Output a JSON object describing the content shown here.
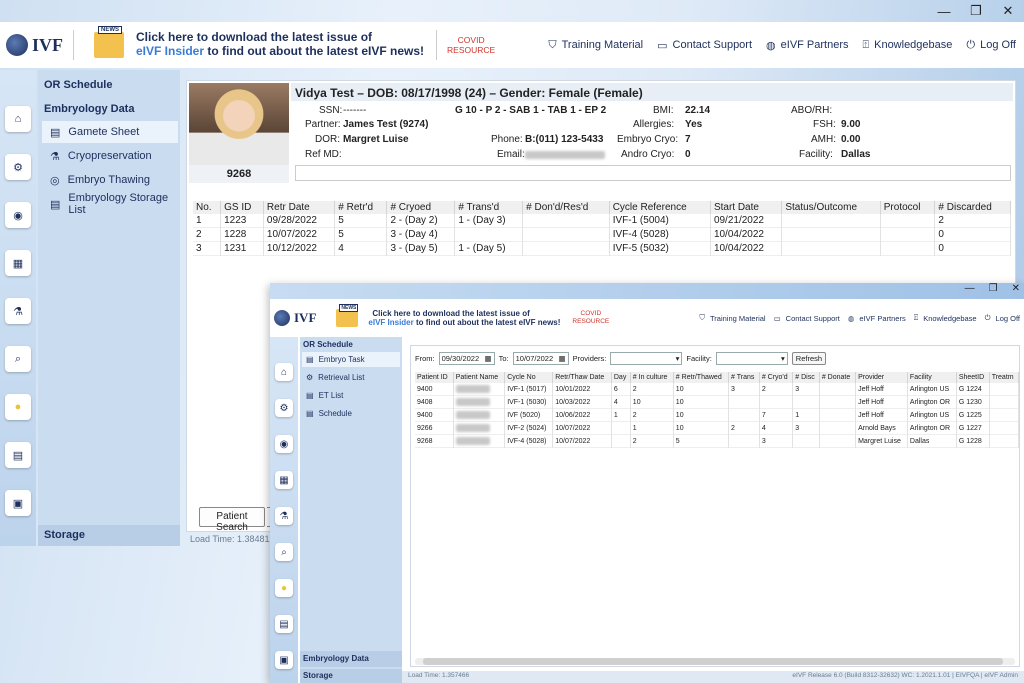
{
  "main": {
    "banner": {
      "line1": "Click here to download the latest issue of",
      "line2_hl": "eIVF Insider",
      "line2_rest": " to find out about the latest eIVF news!"
    },
    "covid": [
      "COVID",
      "RESOURCE"
    ],
    "logo_text": "IVF",
    "news_label": "NEWS",
    "nav": [
      "Training Material",
      "Contact Support",
      "eIVF Partners",
      "Knowledgebase",
      "Log Off"
    ],
    "menu": {
      "or_schedule": "OR Schedule",
      "embryology_data": "Embryology Data",
      "items": [
        "Gamete Sheet",
        "Cryopreservation",
        "Embryo Thawing",
        "Embryology Storage List"
      ],
      "storage": "Storage"
    },
    "patient": {
      "header": "Vidya  Test  – DOB: 08/17/1998 (24) – Gender: Female (Female)",
      "id": "9268",
      "ssn_label": "SSN:",
      "ssn": "-------",
      "partner_label": "Partner:",
      "partner": "James  Test (9274)",
      "dor_label": "DOR:",
      "dor": "Margret Luise",
      "refmd_label": "Ref MD:",
      "gpa": "G 10 - P 2 - SAB 1 - TAB 1 - EP 2",
      "phone_label": "Phone:",
      "phone": "B:(011) 123-5433",
      "email_label": "Email:",
      "bmi_label": "BMI:",
      "bmi": "22.14",
      "allergies_label": "Allergies:",
      "allergies": "Yes",
      "embryo_cryo_label": "Embryo Cryo:",
      "embryo_cryo": "7",
      "andro_cryo_label": "Andro Cryo:",
      "andro_cryo": "0",
      "abo_label": "ABO/RH:",
      "fsh_label": "FSH:",
      "fsh": "9.00",
      "amh_label": "AMH:",
      "amh": "0.00",
      "facility_label": "Facility:",
      "facility": "Dallas"
    },
    "cycles": {
      "headers": [
        "No.",
        "GS ID",
        "Retr Date",
        "# Retr'd",
        "# Cryoed",
        "# Trans'd",
        "# Don'd/Res'd",
        "Cycle Reference",
        "Start Date",
        "Status/Outcome",
        "Protocol",
        "# Discarded"
      ],
      "rows": [
        [
          "1",
          "1223",
          "09/28/2022",
          "5",
          "2 - (Day 2)",
          "1 - (Day 3)",
          "",
          "IVF-1 (5004)",
          "09/21/2022",
          "",
          "",
          "2"
        ],
        [
          "2",
          "1228",
          "10/07/2022",
          "5",
          "3 - (Day 4)",
          "",
          "",
          "IVF-4 (5028)",
          "10/04/2022",
          "",
          "",
          "0"
        ],
        [
          "3",
          "1231",
          "10/12/2022",
          "4",
          "3 - (Day 5)",
          "1 - (Day 5)",
          "",
          "IVF-5 (5032)",
          "10/04/2022",
          "",
          "",
          "0"
        ]
      ]
    },
    "patient_search": "Patient Search",
    "load_time": "Load Time: 1.38481"
  },
  "second": {
    "menu": {
      "or_schedule": "OR Schedule",
      "items": [
        "Embryo Task",
        "Retrieval List",
        "ET List",
        "Schedule"
      ],
      "embryology_data": "Embryology Data",
      "storage": "Storage"
    },
    "filters": {
      "from_label": "From:",
      "from": "09/30/2022",
      "to_label": "To:",
      "to": "10/07/2022",
      "providers_label": "Providers:",
      "facility_label": "Facility:",
      "refresh": "Refresh"
    },
    "table": {
      "headers": [
        "Patient ID",
        "Patient Name",
        "Cycle No",
        "Retr/Thaw Date",
        "Day",
        "# In culture",
        "# Retr/Thawed",
        "# Trans",
        "# Cryo'd",
        "# Disc",
        "# Donate",
        "Provider",
        "Facility",
        "SheetID",
        "Treatm"
      ],
      "rows": [
        [
          "9400",
          "",
          "IVF-1 (5017)",
          "10/01/2022",
          "6",
          "2",
          "10",
          "3",
          "2",
          "3",
          "",
          "Jeff Hoff",
          "Arlington US",
          "G 1224",
          ""
        ],
        [
          "9408",
          "",
          "IVF-1 (5030)",
          "10/03/2022",
          "4",
          "10",
          "10",
          "",
          "",
          "",
          "",
          "Jeff Hoff",
          "Arlington OR",
          "G 1230",
          ""
        ],
        [
          "9400",
          "",
          "IVF (5020)",
          "10/06/2022",
          "1",
          "2",
          "10",
          "",
          "7",
          "1",
          "",
          "Jeff Hoff",
          "Arlington US",
          "G 1225",
          ""
        ],
        [
          "9266",
          "",
          "IVF-2 (5024)",
          "10/07/2022",
          "",
          "1",
          "10",
          "2",
          "4",
          "3",
          "",
          "Arnold Bays",
          "Arlington OR",
          "G 1227",
          ""
        ],
        [
          "9268",
          "",
          "IVF-4 (5028)",
          "10/07/2022",
          "",
          "2",
          "5",
          "",
          "3",
          "",
          "",
          "Margret Luise",
          "Dallas",
          "G 1228",
          ""
        ]
      ]
    },
    "load_time": "Load Time: 1.357466",
    "release": "eIVF Release 6.0 (Build 8312-32632) WC: 1.2021.1.01  |  EIVFQA  |  eIVF Admin"
  },
  "colors": {
    "navy": "#1d2f5c",
    "accent": "#3a7bd5",
    "covid": "#d1352b",
    "menu": "#c9dcf0"
  }
}
